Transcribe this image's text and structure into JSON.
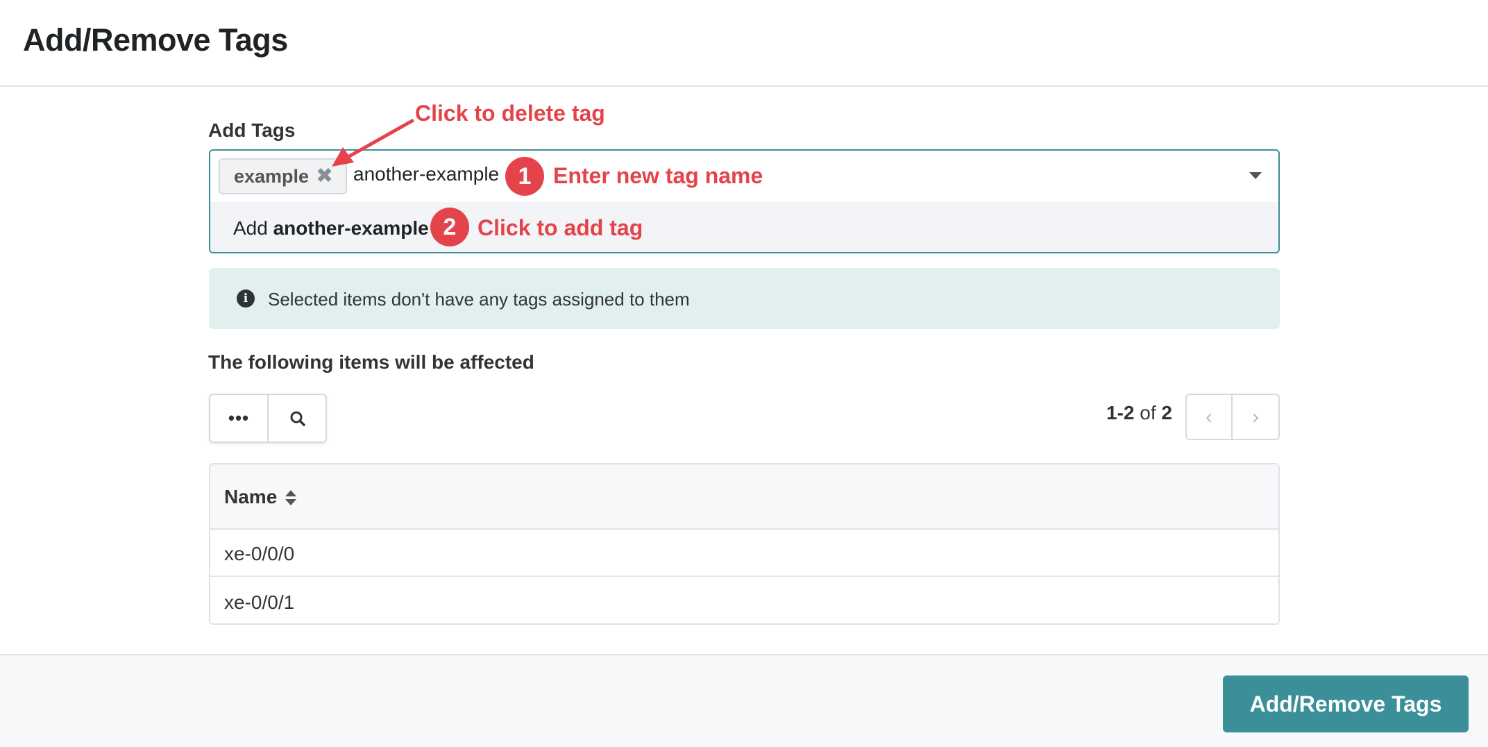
{
  "header": {
    "title": "Add/Remove Tags"
  },
  "add_tags": {
    "label": "Add Tags",
    "chip_label": "example",
    "input_value": "another-example",
    "option_prefix": "Add",
    "option_value": "another-example"
  },
  "info": {
    "message": "Selected items don't have any tags assigned to them"
  },
  "affected": {
    "label": "The following items will be affected"
  },
  "toolbar": {
    "more_label": "•••"
  },
  "pagination": {
    "range": "1-2",
    "of": "of",
    "total": "2"
  },
  "table": {
    "column_name": "Name",
    "rows": [
      {
        "name": "xe-0/0/0"
      },
      {
        "name": "xe-0/0/1"
      }
    ]
  },
  "footer": {
    "submit_label": "Add/Remove Tags"
  },
  "annotations": {
    "delete_tag": "Click to delete tag",
    "step1_number": "1",
    "step1_text": "Enter new tag name",
    "step2_number": "2",
    "step2_text": "Click to add tag",
    "color": "#e5434a"
  },
  "colors": {
    "accent": "#3a8f99",
    "info_bg": "#e1efef"
  }
}
